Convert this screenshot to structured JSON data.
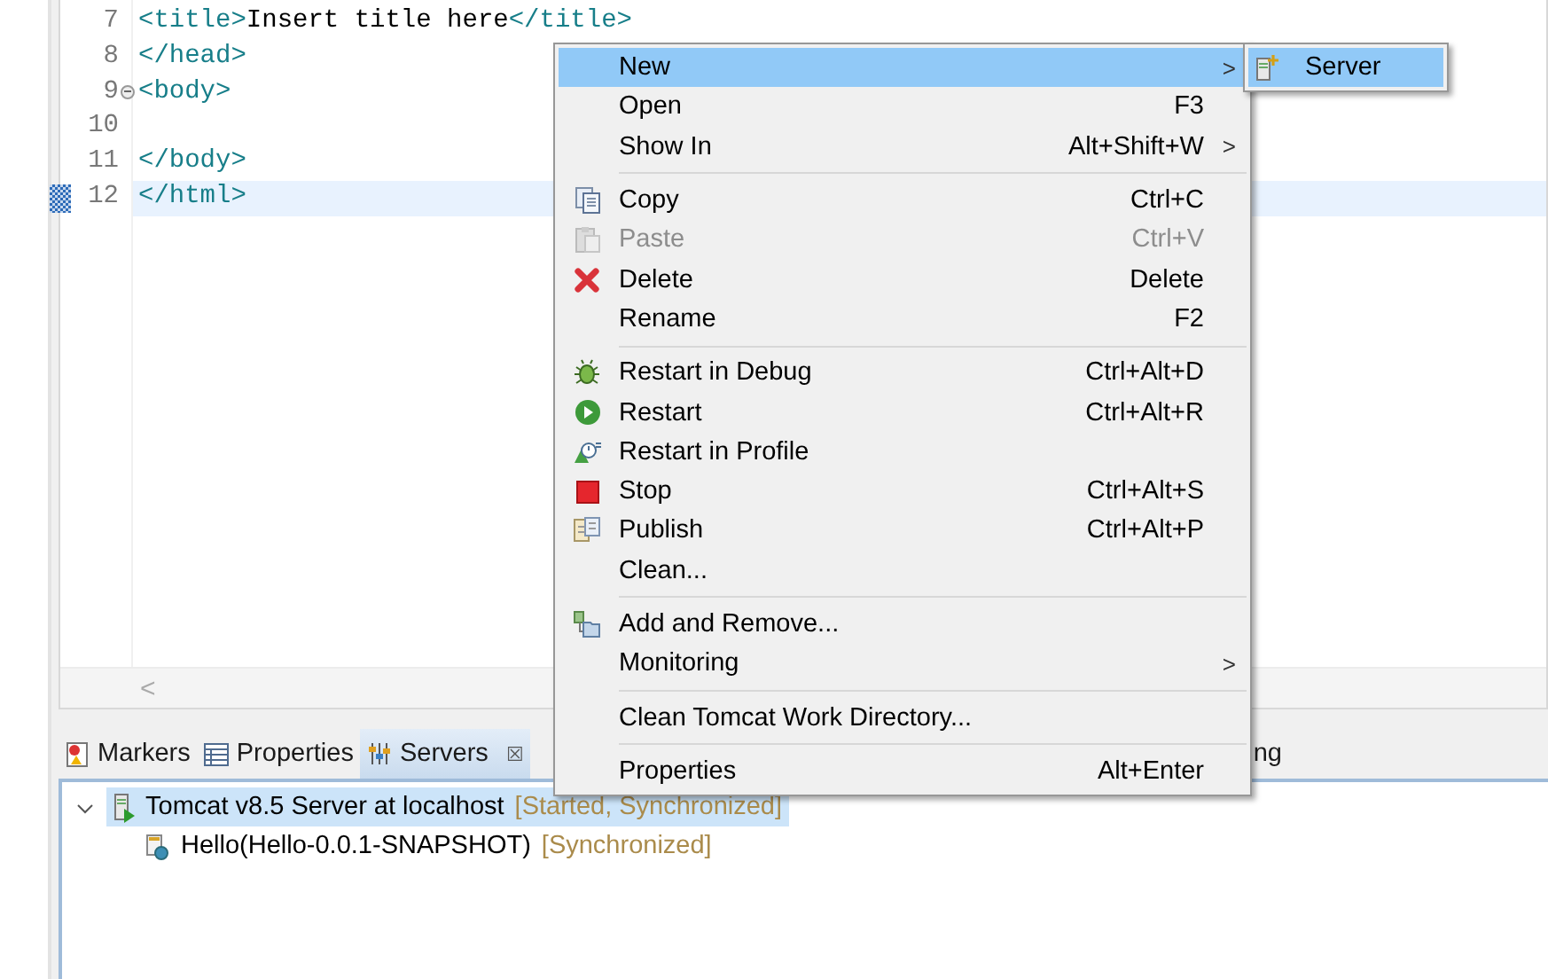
{
  "editor": {
    "lines": [
      {
        "number": "7",
        "collapsible": false,
        "current": false,
        "segments": [
          {
            "kind": "tag",
            "text": "<title>"
          },
          {
            "kind": "text",
            "text": "Insert title here"
          },
          {
            "kind": "tag",
            "text": "</title>"
          }
        ]
      },
      {
        "number": "8",
        "collapsible": false,
        "current": false,
        "segments": [
          {
            "kind": "tag",
            "text": "</head>"
          }
        ]
      },
      {
        "number": "9",
        "collapsible": true,
        "current": false,
        "segments": [
          {
            "kind": "tag",
            "text": "<body>"
          }
        ]
      },
      {
        "number": "10",
        "collapsible": false,
        "current": false
      },
      {
        "number": "11",
        "collapsible": false,
        "current": false,
        "segments": [
          {
            "kind": "tag",
            "text": "</body>"
          }
        ]
      },
      {
        "number": "12",
        "collapsible": false,
        "current": true,
        "segments": [
          {
            "kind": "tag",
            "text": "</html>"
          }
        ]
      }
    ],
    "scroll_left": "<"
  },
  "panel": {
    "tabs": [
      {
        "label": "Markers",
        "selected": false
      },
      {
        "label": "Properties",
        "selected": false
      },
      {
        "label": "Servers",
        "selected": true,
        "close": "☒"
      },
      {
        "label": "ng",
        "selected": false
      }
    ],
    "tree": [
      {
        "name": "Tomcat v8.5 Server at localhost",
        "status": "[Started, Synchronized]",
        "expanded": true,
        "selected": true,
        "children": [
          {
            "name": "Hello(Hello-0.0.1-SNAPSHOT)",
            "status": "[Synchronized]",
            "selected": false
          }
        ]
      }
    ]
  },
  "context_menu": {
    "items": [
      {
        "kind": "item",
        "label": "New",
        "submenu": true,
        "disabled": false,
        "selected": true
      },
      {
        "kind": "item",
        "label": "Open",
        "shortcut": "F3",
        "submenu": false,
        "disabled": false,
        "selected": false
      },
      {
        "kind": "item",
        "label": "Show In",
        "shortcut": "Alt+Shift+W",
        "submenu": true,
        "disabled": false,
        "selected": false
      },
      {
        "kind": "separator"
      },
      {
        "kind": "item",
        "label": "Copy",
        "shortcut": "Ctrl+C",
        "submenu": false,
        "disabled": false,
        "selected": false
      },
      {
        "kind": "item",
        "label": "Paste",
        "shortcut": "Ctrl+V",
        "submenu": false,
        "disabled": true,
        "selected": false
      },
      {
        "kind": "item",
        "label": "Delete",
        "shortcut": "Delete",
        "submenu": false,
        "disabled": false,
        "selected": false
      },
      {
        "kind": "item",
        "label": "Rename",
        "shortcut": "F2",
        "submenu": false,
        "disabled": false,
        "selected": false
      },
      {
        "kind": "separator"
      },
      {
        "kind": "item",
        "label": "Restart in Debug",
        "shortcut": "Ctrl+Alt+D",
        "submenu": false,
        "disabled": false,
        "selected": false
      },
      {
        "kind": "item",
        "label": "Restart",
        "shortcut": "Ctrl+Alt+R",
        "submenu": false,
        "disabled": false,
        "selected": false
      },
      {
        "kind": "item",
        "label": "Restart in Profile",
        "submenu": false,
        "disabled": false,
        "selected": false
      },
      {
        "kind": "item",
        "label": "Stop",
        "shortcut": "Ctrl+Alt+S",
        "submenu": false,
        "disabled": false,
        "selected": false
      },
      {
        "kind": "item",
        "label": "Publish",
        "shortcut": "Ctrl+Alt+P",
        "submenu": false,
        "disabled": false,
        "selected": false
      },
      {
        "kind": "item",
        "label": "Clean...",
        "submenu": false,
        "disabled": false,
        "selected": false
      },
      {
        "kind": "separator"
      },
      {
        "kind": "item",
        "label": "Add and Remove...",
        "submenu": false,
        "disabled": false,
        "selected": false
      },
      {
        "kind": "item",
        "label": "Monitoring",
        "submenu": true,
        "disabled": false,
        "selected": false
      },
      {
        "kind": "separator"
      },
      {
        "kind": "item",
        "label": "Clean Tomcat Work Directory...",
        "submenu": false,
        "disabled": false,
        "selected": false
      },
      {
        "kind": "separator"
      },
      {
        "kind": "item",
        "label": "Properties",
        "shortcut": "Alt+Enter",
        "submenu": false,
        "disabled": false,
        "selected": false
      }
    ],
    "submenu_arrow": ">",
    "submenu": {
      "items": [
        {
          "label": "Server",
          "selected": true
        }
      ]
    }
  }
}
